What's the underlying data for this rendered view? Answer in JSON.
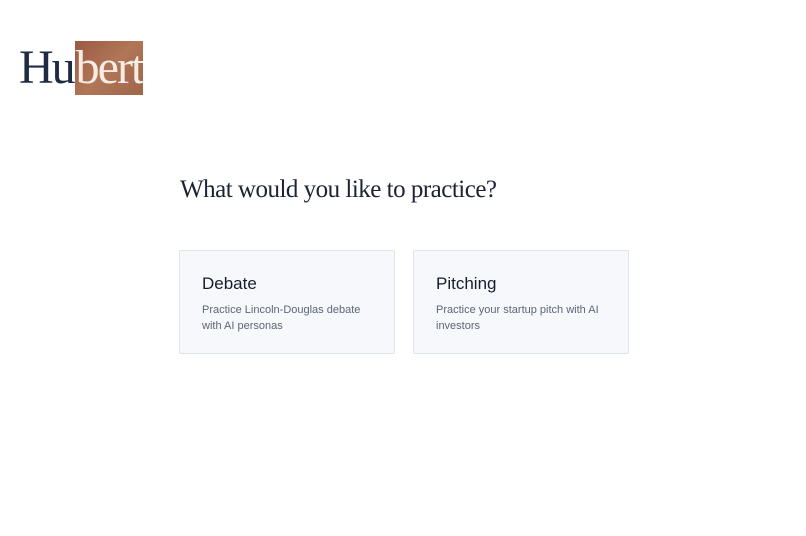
{
  "brand": {
    "part_a": "Hu",
    "part_b": "bert",
    "accent_color": "#a8694e"
  },
  "main": {
    "heading": "What would you like to practice?",
    "options": [
      {
        "title": "Debate",
        "description": "Practice Lincoln-Douglas debate with AI personas"
      },
      {
        "title": "Pitching",
        "description": "Practice your startup pitch with AI investors"
      }
    ]
  }
}
